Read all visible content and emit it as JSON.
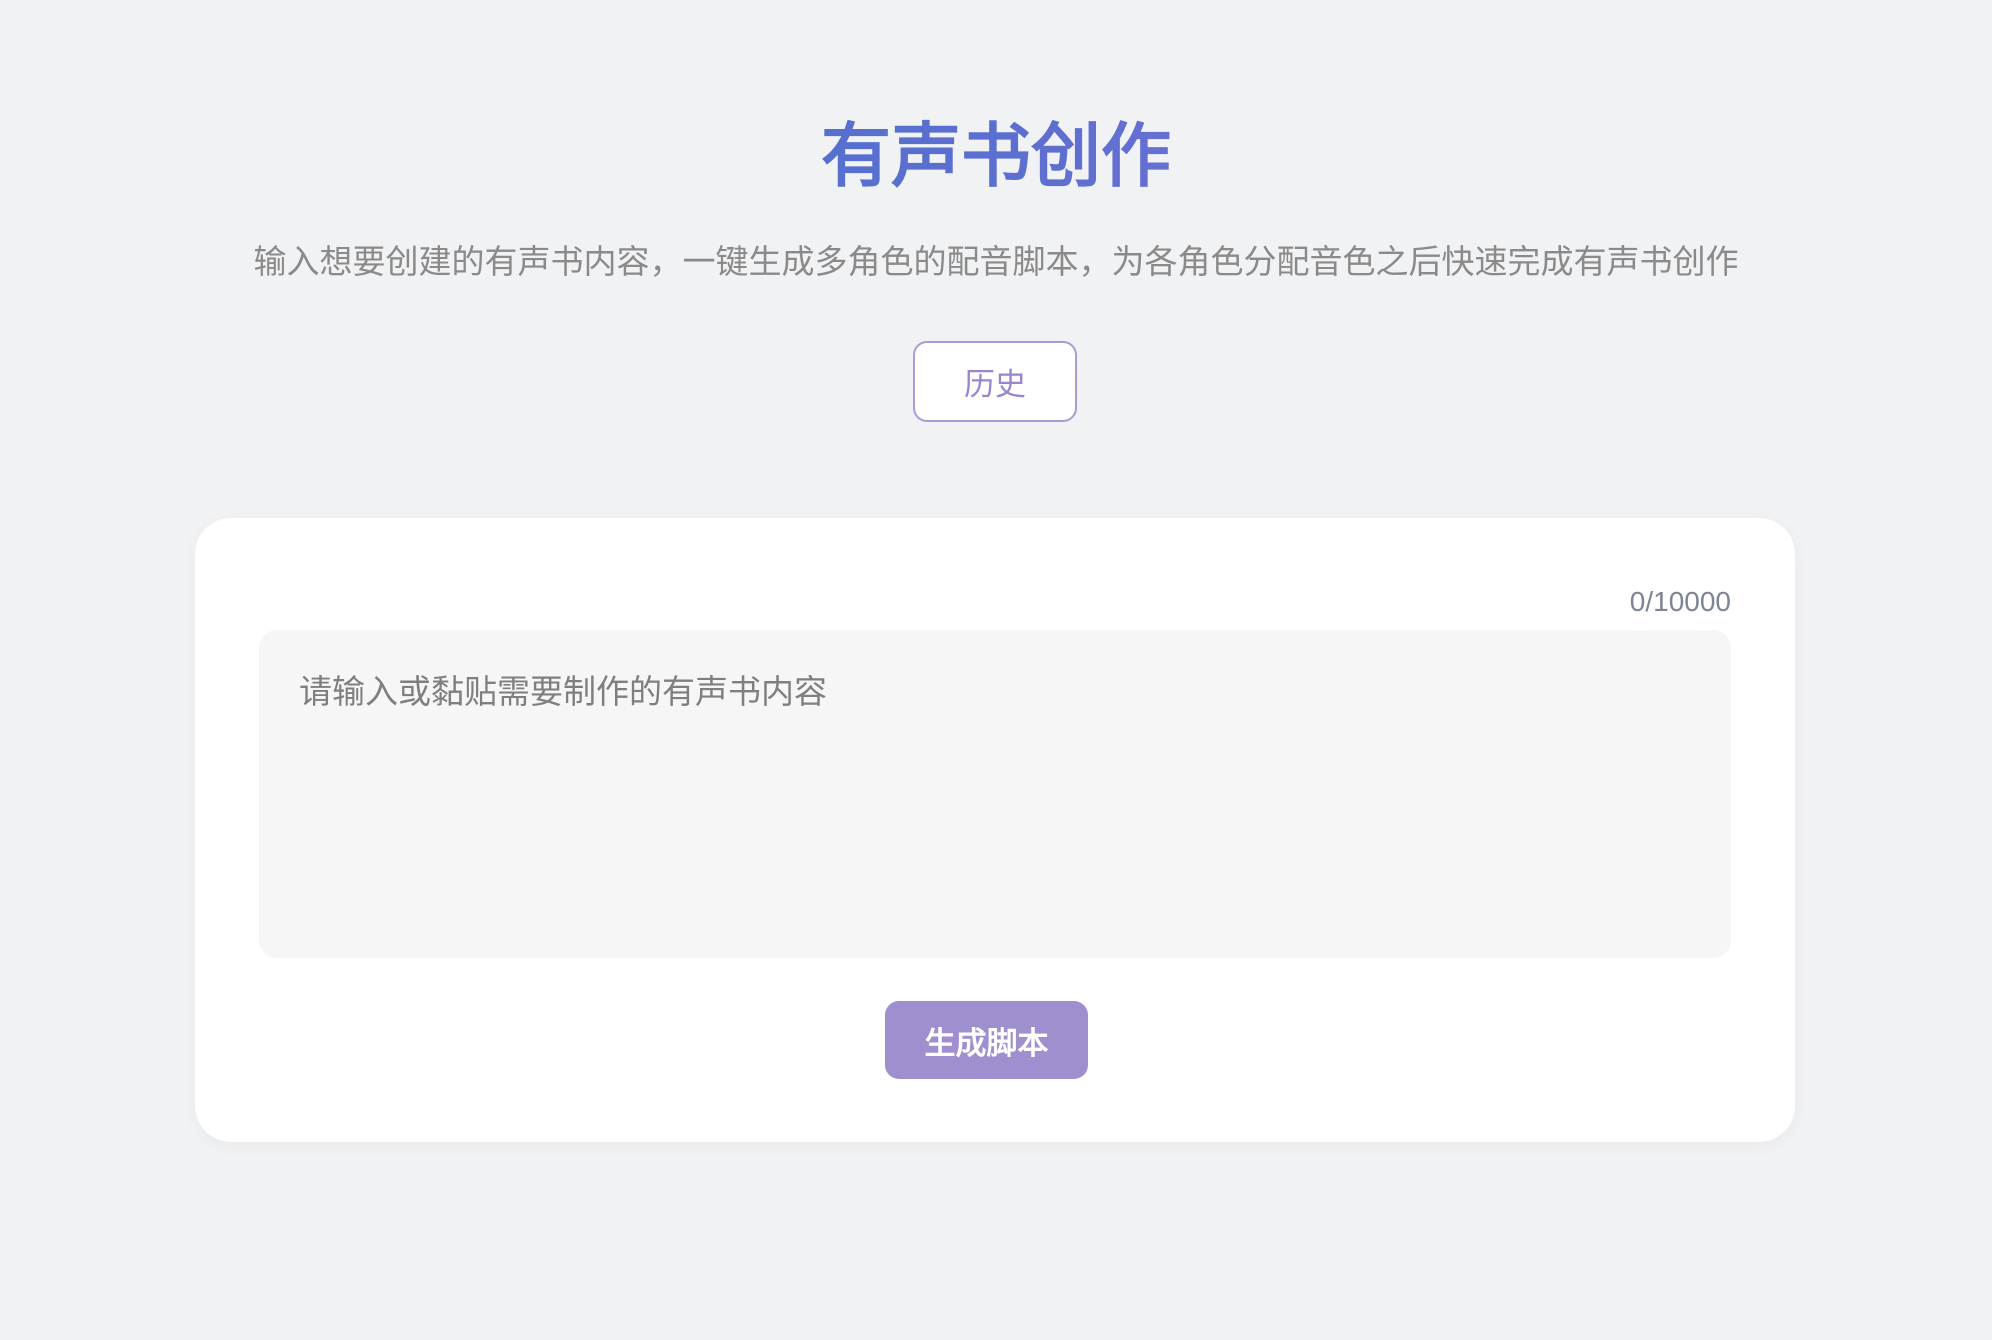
{
  "header": {
    "title": "有声书创作",
    "subtitle": "输入想要创建的有声书内容，一键生成多角色的配音脚本，为各角色分配音色之后快速完成有声书创作",
    "history_label": "历史"
  },
  "editor": {
    "char_count": "0/10000",
    "placeholder": "请输入或黏贴需要制作的有声书内容",
    "value": "",
    "generate_label": "生成脚本"
  },
  "colors": {
    "page_background": "#f1f2f4",
    "title_gradient_start": "#3f73c7",
    "title_gradient_end": "#9a72d8",
    "accent": "#9f8fcf",
    "history_border": "#a89bd6"
  }
}
